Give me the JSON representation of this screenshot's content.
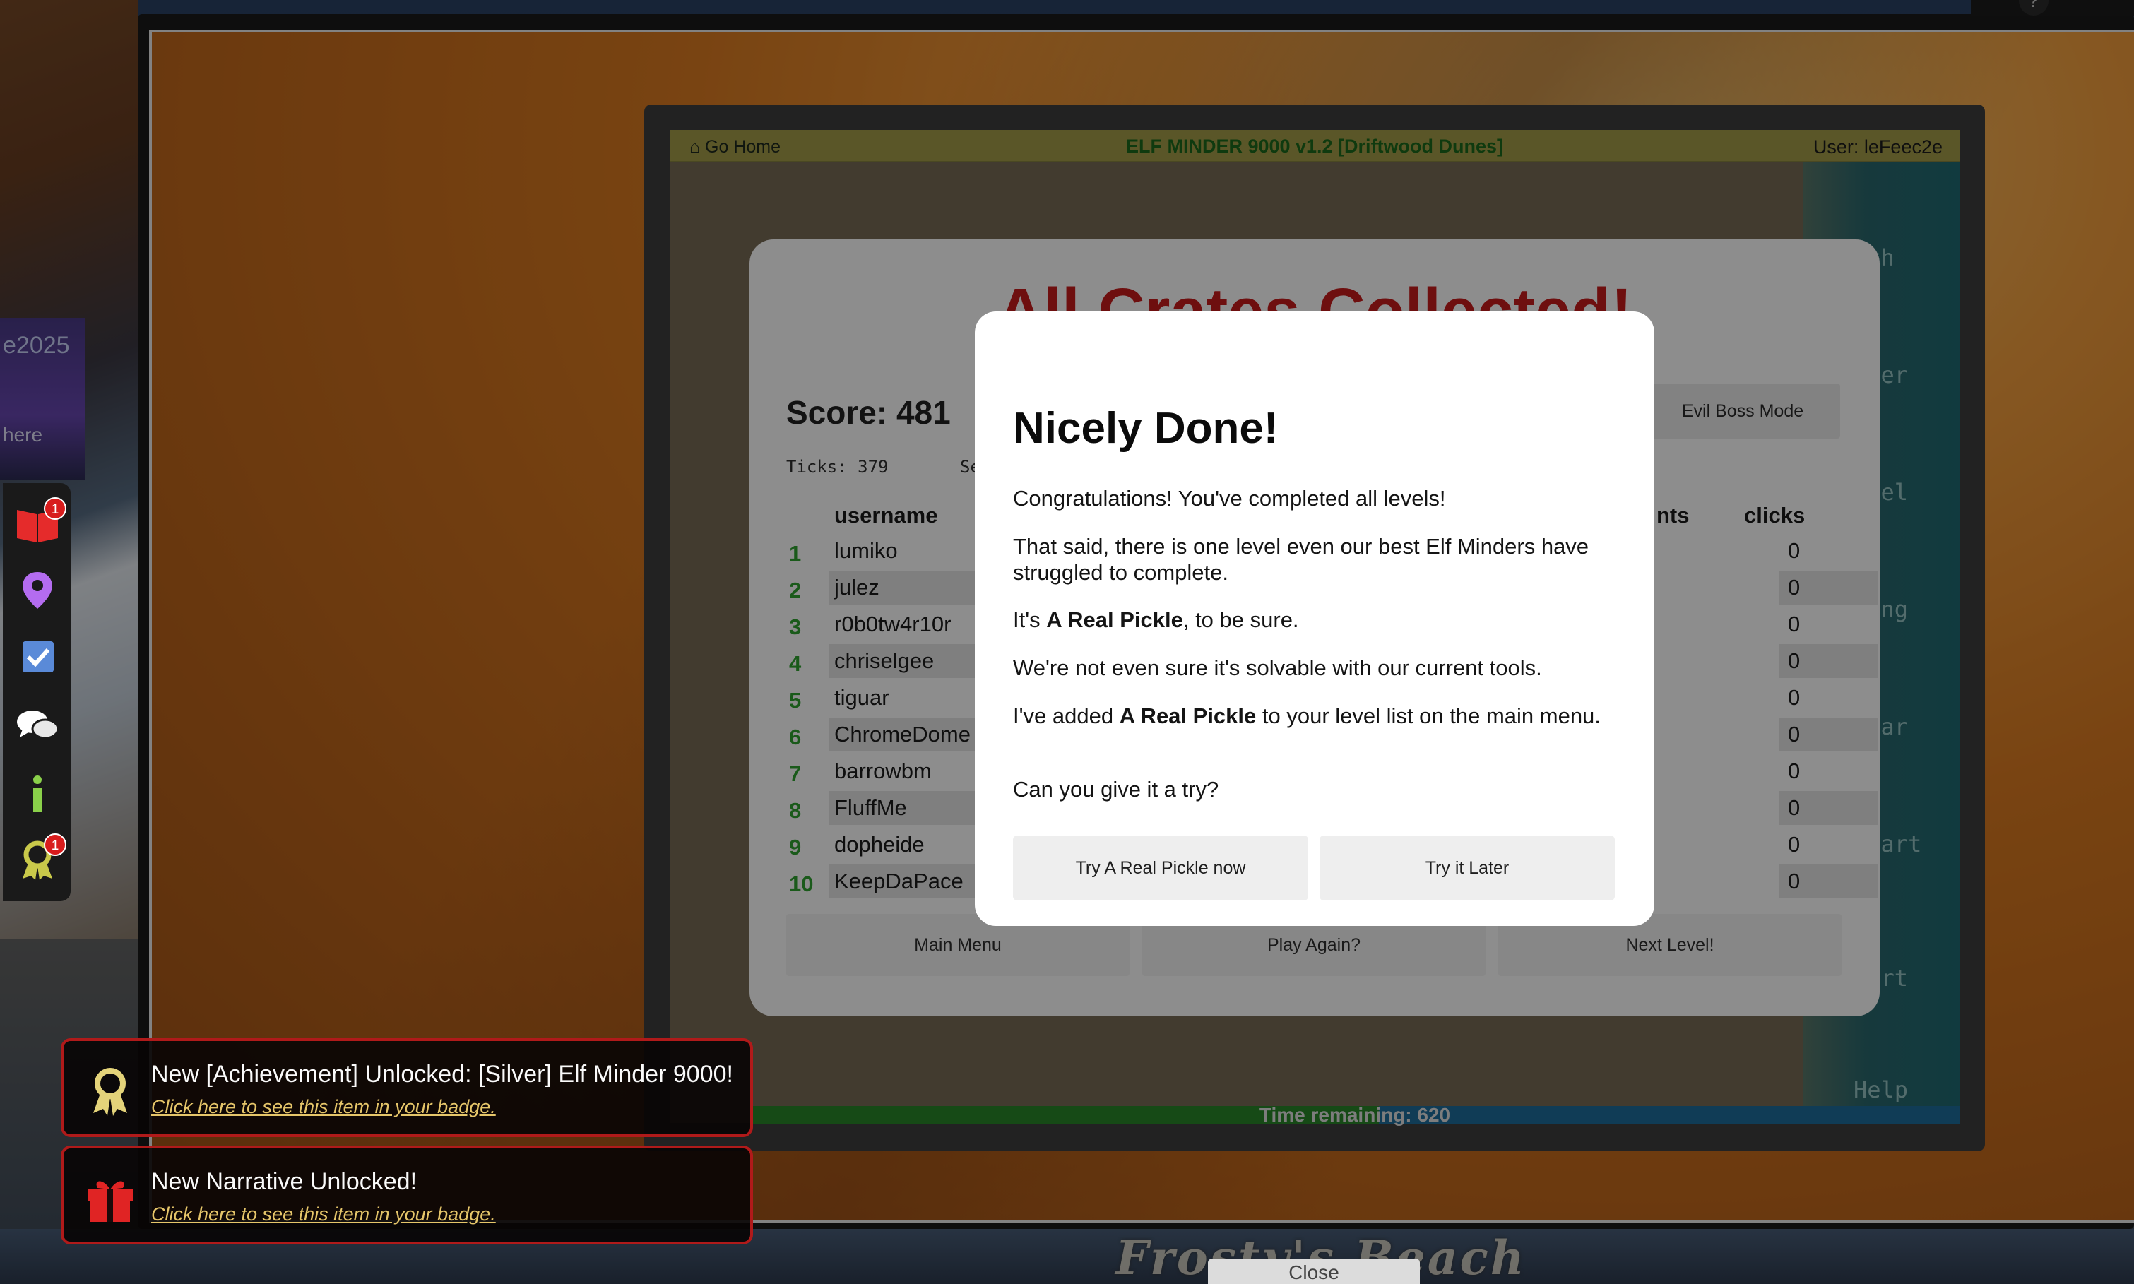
{
  "world": {
    "beach_sign": "Frosty's Beach",
    "poster_top": "e2025",
    "poster_bottom": "here",
    "close_label": "Close"
  },
  "game": {
    "home_label": "Go Home",
    "title": "ELF MINDER 9000 v1.2 [Driftwood Dunes]",
    "user_label": "User: leFeec2e",
    "time_remaining": "Time remaining: 620",
    "tools": [
      "ath",
      "aser",
      "nnel",
      "ring",
      "lear",
      "start",
      "tart",
      "Help"
    ]
  },
  "results": {
    "heading": "All Crates Collected!",
    "score": "Score: 481",
    "ticks": "Ticks: 379",
    "ticks_suffix": "Se",
    "evil_boss_label": "Evil Boss Mode",
    "columns": {
      "username": "username",
      "points": "nts",
      "clicks": "clicks"
    },
    "leaderboard": [
      {
        "rank": "1",
        "username": "lumiko",
        "clicks": "0"
      },
      {
        "rank": "2",
        "username": "julez",
        "clicks": "0"
      },
      {
        "rank": "3",
        "username": "r0b0tw4r10r",
        "clicks": "0"
      },
      {
        "rank": "4",
        "username": "chriselgee",
        "clicks": "0"
      },
      {
        "rank": "5",
        "username": "tiguar",
        "clicks": "0"
      },
      {
        "rank": "6",
        "username": "ChromeDome",
        "clicks": "0"
      },
      {
        "rank": "7",
        "username": "barrowbm",
        "clicks": "0"
      },
      {
        "rank": "8",
        "username": "FluffMe",
        "clicks": "0"
      },
      {
        "rank": "9",
        "username": "dopheide",
        "clicks": "0"
      },
      {
        "rank": "10",
        "username": "KeepDaPace",
        "clicks": "0"
      }
    ],
    "actions": {
      "main_menu": "Main Menu",
      "play_again": "Play Again?",
      "next_level": "Next Level!"
    }
  },
  "modal": {
    "title": "Nicely Done!",
    "p1": "Congratulations! You've completed all levels!",
    "p2": "That said, there is one level even our best Elf Minders have struggled to complete.",
    "p3_pre": "It's ",
    "p3_bold": "A Real Pickle",
    "p3_post": ", to be sure.",
    "p4": "We're not even sure it's solvable with our current tools.",
    "p5_pre": "I've added ",
    "p5_bold": "A Real Pickle",
    "p5_post": " to your level list on the main menu.",
    "p6": "Can you give it a try?",
    "try_now": "Try A Real Pickle now",
    "try_later": "Try it Later"
  },
  "sidebar": {
    "badge_count_book": "1",
    "badge_count_achievements": "1",
    "icons": [
      "book-icon",
      "map-pin-icon",
      "checkbox-icon",
      "chat-icon",
      "info-icon",
      "achievement-icon"
    ]
  },
  "notifications": [
    {
      "title": "New [Achievement] Unlocked: [Silver] Elf Minder 9000!",
      "link": "Click here to see this item in your badge.",
      "icon": "award-ribbon-icon"
    },
    {
      "title": "New Narrative Unlocked!",
      "link": "Click here to see this item in your badge.",
      "icon": "gift-icon"
    }
  ],
  "colors": {
    "accent_red": "#b01a1a",
    "heading_dark_red": "#6e0f0f",
    "rank_green": "#1a5a1a",
    "sidebar_green": "#8ad04a",
    "sidebar_purple": "#b46cf0",
    "sidebar_blue": "#5a8ad8",
    "link_gold": "#e6c66a"
  }
}
